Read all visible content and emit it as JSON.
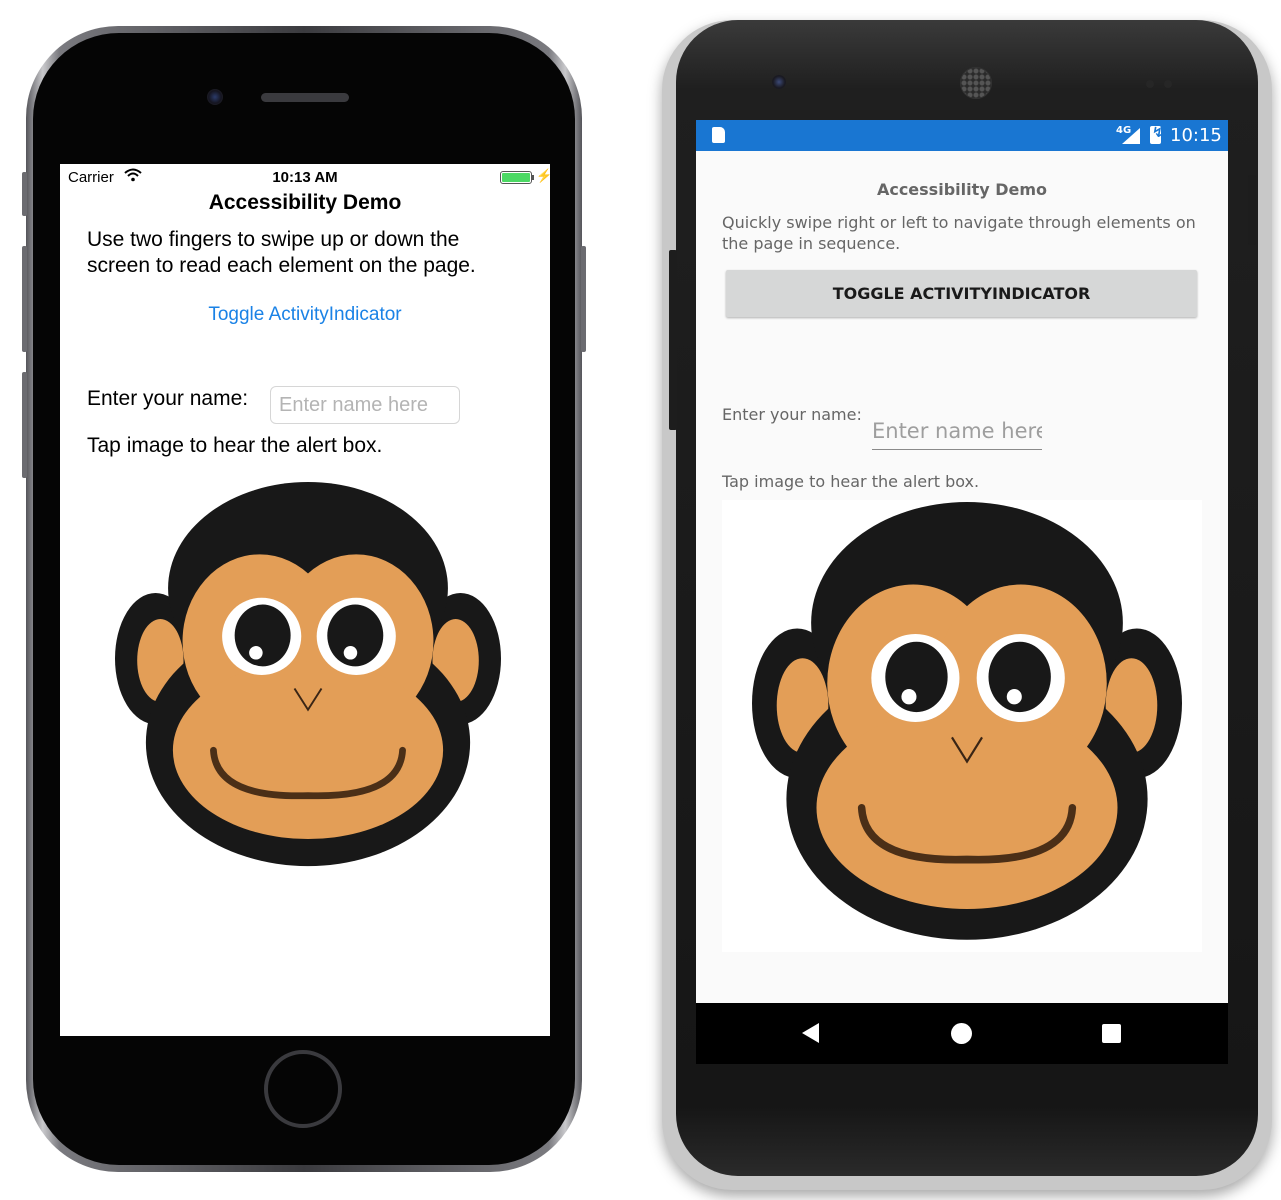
{
  "ios": {
    "status": {
      "carrier": "Carrier",
      "time": "10:13 AM",
      "battery_level": 1.0
    },
    "title": "Accessibility Demo",
    "instructions": "Use two fingers to swipe up or down the screen to read each element on the page.",
    "toggle_label": "Toggle ActivityIndicator",
    "name_label": "Enter your name:",
    "name_placeholder": "Enter name here",
    "tap_label": "Tap image to hear the alert box.",
    "accent_color": "#1a82e6"
  },
  "android": {
    "status": {
      "network": "4G",
      "time": "10:15",
      "bar_color": "#1976d2"
    },
    "title": "Accessibility Demo",
    "instructions": "Quickly swipe right or left to navigate through elements on the page in sequence.",
    "toggle_label": "TOGGLE ACTIVITYINDICATOR",
    "name_label": "Enter your name:",
    "name_placeholder": "Enter name here",
    "tap_label": "Tap image to hear the alert box."
  },
  "monkey_colors": {
    "fur": "#181818",
    "face": "#e39e57",
    "mouth": "#4b2f17"
  }
}
